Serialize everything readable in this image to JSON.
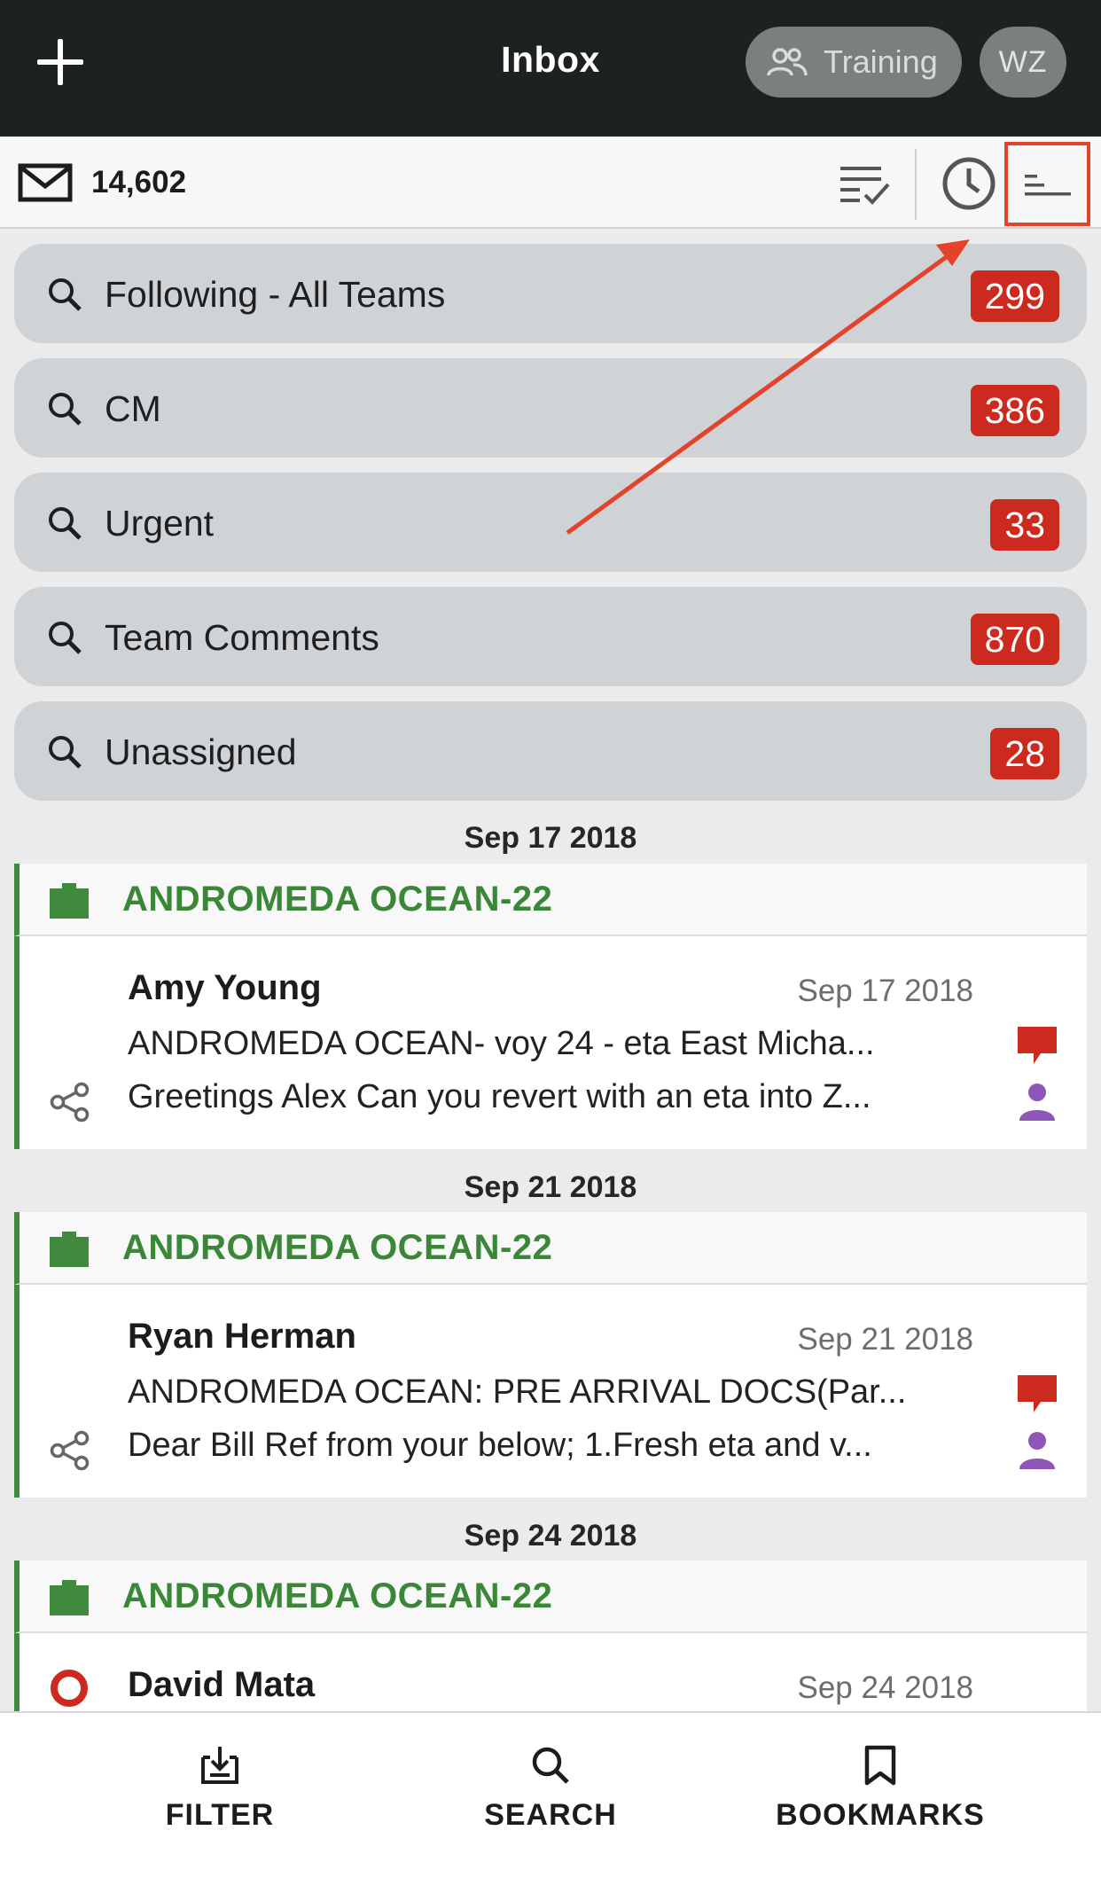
{
  "header": {
    "title": "Inbox",
    "training_label": "Training",
    "avatar_initials": "WZ"
  },
  "toolbar": {
    "mail_count": "14,602"
  },
  "saved_searches": [
    {
      "label": "Following - All Teams",
      "count": "299"
    },
    {
      "label": "CM",
      "count": "386"
    },
    {
      "label": "Urgent",
      "count": "33"
    },
    {
      "label": "Team Comments",
      "count": "870"
    },
    {
      "label": "Unassigned",
      "count": "28"
    }
  ],
  "groups": [
    {
      "date": "Sep 17 2018",
      "case_title": "ANDROMEDA OCEAN-22",
      "sender": "Amy Young",
      "msg_date": "Sep 17 2018",
      "subject": "ANDROMEDA OCEAN- voy 24 - eta East Micha...",
      "preview": "Greetings Alex Can you revert with an eta into Z..."
    },
    {
      "date": "Sep 21 2018",
      "case_title": "ANDROMEDA OCEAN-22",
      "sender": "Ryan Herman",
      "msg_date": "Sep 21 2018",
      "subject": "ANDROMEDA OCEAN: PRE ARRIVAL DOCS(Par...",
      "preview": "Dear Bill Ref from your below; 1.Fresh eta and v..."
    },
    {
      "date": "Sep 24 2018",
      "case_title": "ANDROMEDA OCEAN-22",
      "sender": "David Mata",
      "msg_date": "Sep 24 2018"
    }
  ],
  "bottom_tabs": [
    {
      "label": "FILTER",
      "icon": "filter-icon"
    },
    {
      "label": "SEARCH",
      "icon": "search-icon"
    },
    {
      "label": "BOOKMARKS",
      "icon": "bookmark-icon"
    }
  ],
  "colors": {
    "header_bg": "#1e2122",
    "badge_red": "#cc2a1e",
    "case_green": "#3a8738",
    "annotation_red": "#e2432a",
    "person_purple": "#8e56b8"
  }
}
